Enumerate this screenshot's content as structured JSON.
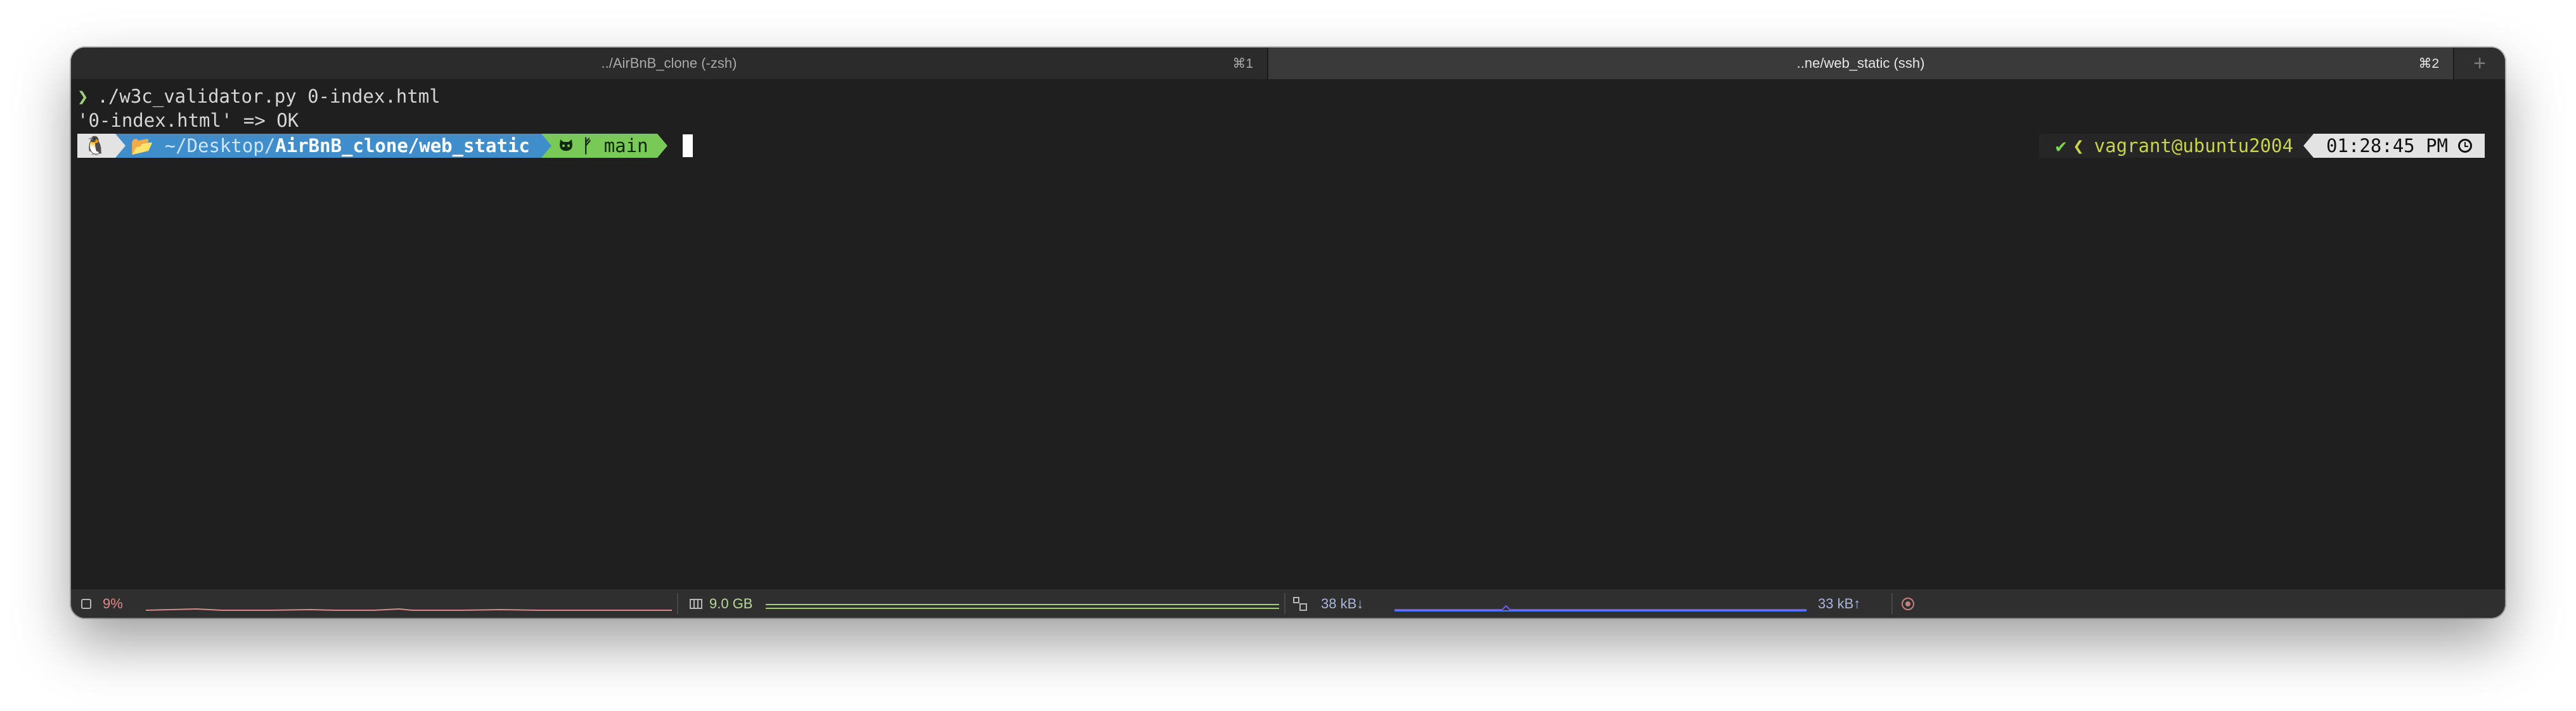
{
  "tabs": [
    {
      "label": "../AirBnB_clone (-zsh)",
      "shortcut": "⌘1",
      "active": false
    },
    {
      "label": "..ne/web_static (ssh)",
      "shortcut": "⌘2",
      "active": true
    }
  ],
  "tab_add_label": "+",
  "terminal": {
    "prompt_symbol": "❯",
    "command": "./w3c_validator.py 0-index.html",
    "output": "'0-index.html' => OK"
  },
  "prompt": {
    "os_icon": "🐧",
    "folder_icon": "📂",
    "dir_prefix": " ~/Desktop/",
    "dir_bold": "AirBnB_clone/web_static",
    "vcs_icon": "github-icon",
    "branch_icon": "ᚠ",
    "branch": " main"
  },
  "rprompt": {
    "status_check": "✔",
    "status_chevron": "❮",
    "user_host": "vagrant@ubuntu2004",
    "time": "01:28:45 PM"
  },
  "statusbar": {
    "cpu": "9%",
    "memory": "9.0 GB",
    "net_down": "38 kB↓",
    "net_up": "33 kB↑"
  },
  "colors": {
    "terminal_bg": "#1f1f1f",
    "dir_segment": "#3f8ecb",
    "vcs_segment": "#79c957",
    "os_segment": "#e3e3e3",
    "cpu_graph": "#d88a8a",
    "mem_graph": "#9ed07a",
    "net_graph": "#6b5cff"
  }
}
